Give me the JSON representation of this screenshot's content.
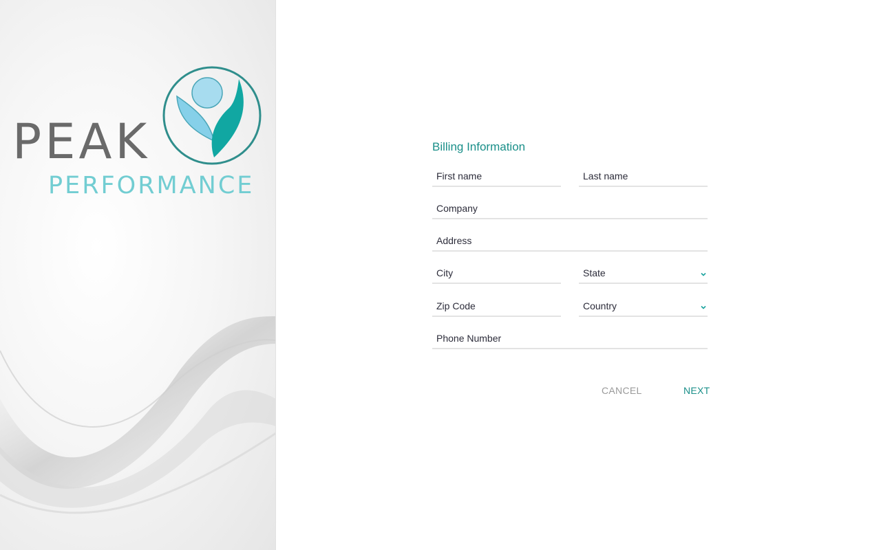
{
  "brand": {
    "line1": "PEAK",
    "line2": "PERFORMANCE",
    "colors": {
      "gray": "#6a6a6a",
      "teal_light": "#72cdd2",
      "teal_dark": "#0f9c96"
    }
  },
  "form": {
    "title": "Billing Information",
    "first_name": {
      "placeholder": "First name",
      "value": ""
    },
    "last_name": {
      "placeholder": "Last name",
      "value": ""
    },
    "company": {
      "placeholder": "Company",
      "value": ""
    },
    "address": {
      "placeholder": "Address",
      "value": ""
    },
    "city": {
      "placeholder": "City",
      "value": ""
    },
    "state": {
      "label": "State",
      "icon": "chevron-down-icon"
    },
    "zip": {
      "placeholder": "Zip Code",
      "value": ""
    },
    "country": {
      "label": "Country",
      "icon": "chevron-down-icon"
    },
    "phone": {
      "placeholder": "Phone Number",
      "value": ""
    }
  },
  "actions": {
    "cancel": "CANCEL",
    "next": "NEXT"
  },
  "colors": {
    "accent": "#1a8f89",
    "muted": "#9a9a9a",
    "underline": "#e3e3e3",
    "text": "#2c2c3a"
  }
}
